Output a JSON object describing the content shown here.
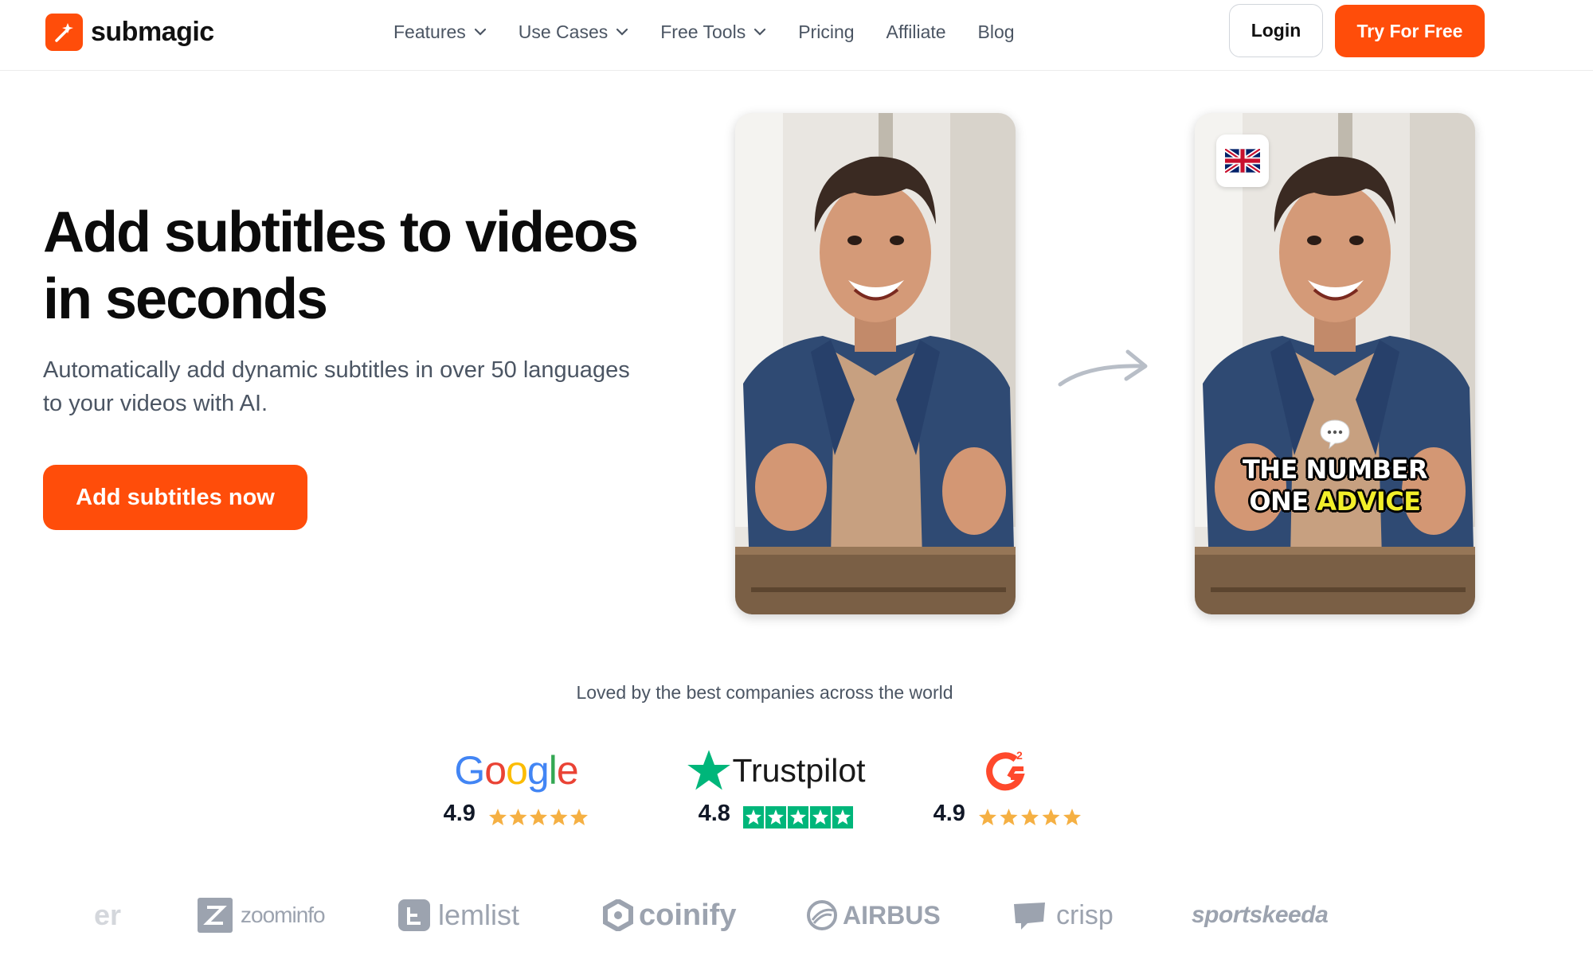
{
  "brand": {
    "name": "submagic",
    "accent": "#ff4d0a"
  },
  "nav": {
    "items": [
      {
        "label": "Features",
        "dropdown": true
      },
      {
        "label": "Use Cases",
        "dropdown": true
      },
      {
        "label": "Free Tools",
        "dropdown": true
      },
      {
        "label": "Pricing",
        "dropdown": false
      },
      {
        "label": "Affiliate",
        "dropdown": false
      },
      {
        "label": "Blog",
        "dropdown": false
      }
    ],
    "login": "Login",
    "try_free": "Try For Free"
  },
  "hero": {
    "title_line1": "Add subtitles to videos",
    "title_line2": "in seconds",
    "subtitle_line1": "Automatically add dynamic subtitles in over 50 languages",
    "subtitle_line2": "to your videos with AI.",
    "cta": "Add subtitles now"
  },
  "demo": {
    "caption_line1": "THE NUMBER",
    "caption_word1": "ONE",
    "caption_highlight": "ADVICE",
    "flag_icon": "uk-flag-icon"
  },
  "social": {
    "loved": "Loved by the best companies across the world",
    "ratings": [
      {
        "platform": "Google",
        "score": "4.9",
        "stars": 5
      },
      {
        "platform": "Trustpilot",
        "score": "4.8",
        "stars": 5
      },
      {
        "platform": "G2",
        "score": "4.9",
        "stars": 5
      }
    ],
    "logos": [
      "er",
      "zoominfo",
      "lemlist",
      "coinify",
      "AIRBUS",
      "crisp",
      "sportskeeda"
    ]
  }
}
